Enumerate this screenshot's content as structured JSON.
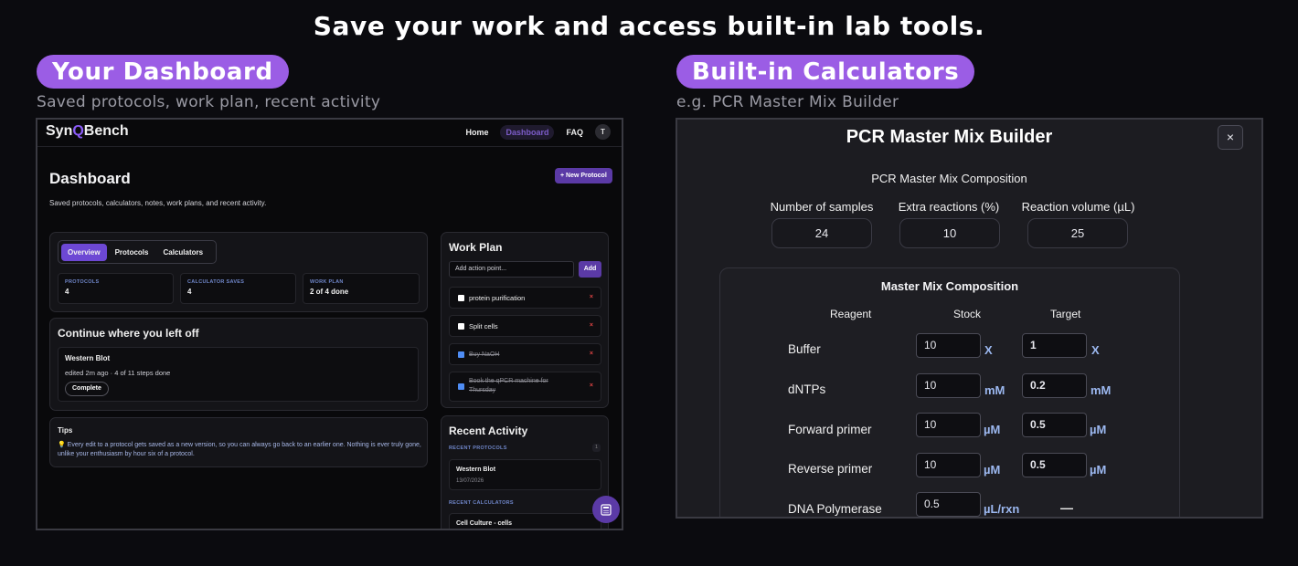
{
  "headline": "Save your work and access built-in lab tools.",
  "left_panel": {
    "pill": "Your Dashboard",
    "caption": "Saved protocols, work plan, recent activity"
  },
  "right_panel": {
    "pill": "Built-in Calculators",
    "caption": "e.g. PCR Master Mix Builder"
  },
  "dashboard": {
    "brand_prefix": "Syn",
    "brand_q": "Q",
    "brand_suffix": "Bench",
    "nav": {
      "home": "Home",
      "dashboard": "Dashboard",
      "faq": "FAQ",
      "avatar": "T"
    },
    "title": "Dashboard",
    "subtitle": "Saved protocols, calculators, notes, work plans, and recent activity.",
    "new_protocol": "+ New Protocol",
    "tabs": {
      "overview": "Overview",
      "protocols": "Protocols",
      "calculators": "Calculators"
    },
    "stats": [
      {
        "label": "PROTOCOLS",
        "value": "4"
      },
      {
        "label": "CALCULATOR SAVES",
        "value": "4"
      },
      {
        "label": "WORK PLAN",
        "value": "2 of 4 done"
      }
    ],
    "continue": {
      "title": "Continue where you left off",
      "item_title": "Western Blot",
      "item_meta": "edited 2m ago · 4 of 11 steps done",
      "button": "Complete"
    },
    "tips": {
      "title": "Tips",
      "text": "💡 Every edit to a protocol gets saved as a new version, so you can always go back to an earlier one. Nothing is ever truly gone, unlike your enthusiasm by hour six of a protocol."
    },
    "work_plan": {
      "title": "Work Plan",
      "placeholder": "Add action point...",
      "add": "Add",
      "items": [
        {
          "text": "protein purification",
          "done": false
        },
        {
          "text": "Split cells",
          "done": false
        },
        {
          "text": "Buy NaOH",
          "done": true
        },
        {
          "text": "Book the qPCR machine for Thursday",
          "done": true
        }
      ],
      "remove": "×"
    },
    "recent": {
      "title": "Recent Activity",
      "protocols_label": "RECENT PROTOCOLS",
      "protocols_count": "1",
      "protocol_item": "Western Blot",
      "protocol_date": "13/07/2026",
      "calculators_label": "RECENT CALCULATORS",
      "calculator_item": "Cell Culture - cells"
    }
  },
  "calculator": {
    "title": "PCR Master Mix Builder",
    "close": "×",
    "section": "PCR Master Mix Composition",
    "fields": [
      {
        "label": "Number of samples",
        "value": "24"
      },
      {
        "label": "Extra reactions (%)",
        "value": "10"
      },
      {
        "label": "Reaction volume (µL)",
        "value": "25"
      }
    ],
    "composition": {
      "title": "Master Mix Composition",
      "headers": {
        "reagent": "Reagent",
        "stock": "Stock",
        "target": "Target"
      },
      "rows": [
        {
          "reagent": "Buffer",
          "stock": "10",
          "stock_unit": "X",
          "target": "1",
          "target_unit": "X"
        },
        {
          "reagent": "dNTPs",
          "stock": "10",
          "stock_unit": "mM",
          "target": "0.2",
          "target_unit": "mM"
        },
        {
          "reagent": "Forward primer",
          "stock": "10",
          "stock_unit": "µM",
          "target": "0.5",
          "target_unit": "µM"
        },
        {
          "reagent": "Reverse primer",
          "stock": "10",
          "stock_unit": "µM",
          "target": "0.5",
          "target_unit": "µM"
        },
        {
          "reagent": "DNA Polymerase",
          "stock": "0.5",
          "stock_unit": "µL/rxn",
          "target": "—",
          "target_unit": ""
        }
      ]
    }
  },
  "colors": {
    "accent_purple": "#9b5de5",
    "button_purple": "#5b3aa6",
    "unit_blue": "#9cb8f0",
    "remove_red": "#e04444"
  }
}
